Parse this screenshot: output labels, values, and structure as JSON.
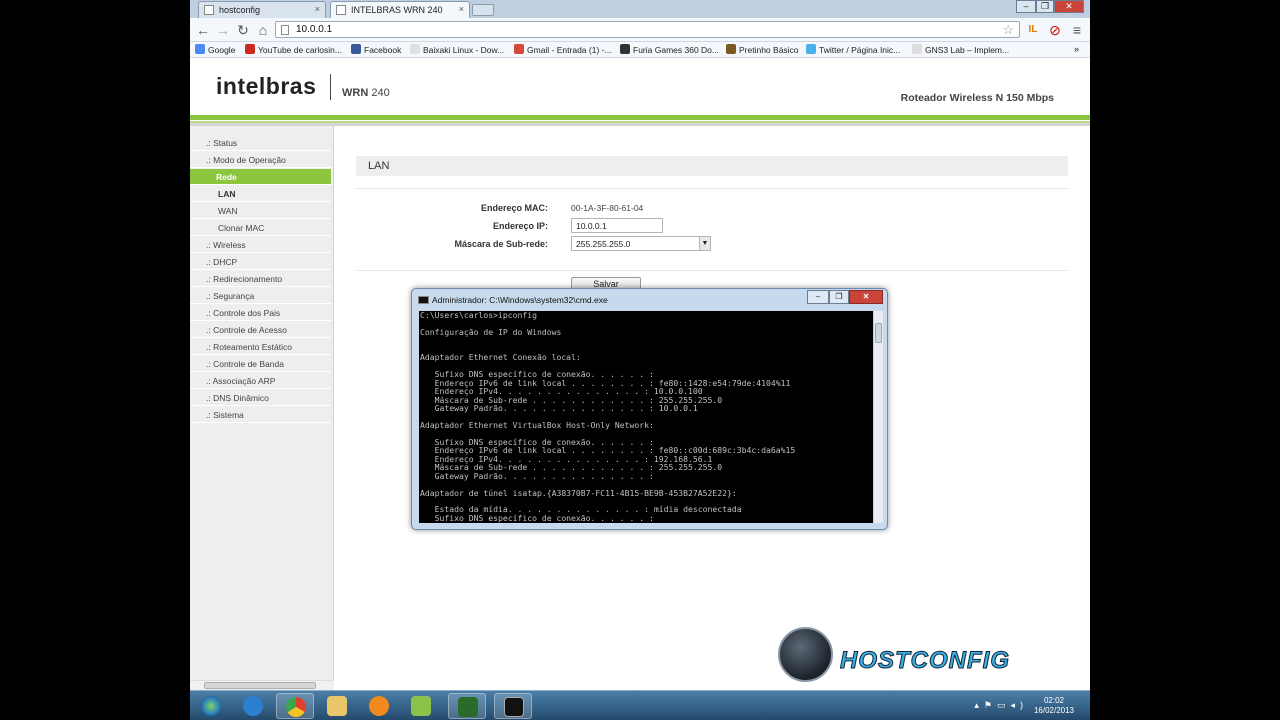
{
  "browser": {
    "tabs": [
      {
        "label": "hostconfig"
      },
      {
        "label": "INTELBRAS WRN 240"
      }
    ],
    "url": "10.0.0.1",
    "bookmarks": [
      {
        "label": "Google",
        "color": "#4a8af4"
      },
      {
        "label": "YouTube de carlosin...",
        "color": "#cc2a1f"
      },
      {
        "label": "Facebook",
        "color": "#3b5998"
      },
      {
        "label": "Baixaki Linux - Dow...",
        "color": "#e0e0e0"
      },
      {
        "label": "Gmail - Entrada (1) -...",
        "color": "#d44a3a"
      },
      {
        "label": "Furia Games 360 Do...",
        "color": "#333333"
      },
      {
        "label": "Pretinho Básico",
        "color": "#7a5a20"
      },
      {
        "label": "Twitter / Página Inic...",
        "color": "#4ab0ea"
      },
      {
        "label": "GNS3 Lab – Implem...",
        "color": "#dddddd"
      }
    ]
  },
  "router": {
    "brand": "intelbras",
    "model_name": "WRN",
    "model_number": "240",
    "description": "Roteador Wireless N 150 Mbps",
    "accent": "#8cc63f"
  },
  "sidebar": {
    "items": [
      {
        "label": ".: Status"
      },
      {
        "label": ".: Modo de Operação"
      },
      {
        "label": "Rede"
      },
      {
        "label": "LAN"
      },
      {
        "label": "WAN"
      },
      {
        "label": "Clonar MAC"
      },
      {
        "label": ".: Wireless"
      },
      {
        "label": ".: DHCP"
      },
      {
        "label": ".: Redirecionamento"
      },
      {
        "label": ".: Segurança"
      },
      {
        "label": ".: Controle dos Pais"
      },
      {
        "label": ".: Controle de Acesso"
      },
      {
        "label": ".: Roteamento Estático"
      },
      {
        "label": ".: Controle de Banda"
      },
      {
        "label": ".: Associação ARP"
      },
      {
        "label": ".: DNS Dinâmico"
      },
      {
        "label": ".: Sistema"
      }
    ]
  },
  "lan": {
    "title": "LAN",
    "mac_label": "Endereço MAC:",
    "mac_value": "00-1A-3F-80-61-04",
    "ip_label": "Endereço IP:",
    "ip_value": "10.0.0.1",
    "mask_label": "Máscara de Sub-rede:",
    "mask_value": "255.255.255.0",
    "save_label": "Salvar"
  },
  "cmd": {
    "title": "Administrador: C:\\Windows\\system32\\cmd.exe",
    "output": "C:\\Users\\carlos>ipconfig\n\nConfiguração de IP do Windows\n\n\nAdaptador Ethernet Conexão local:\n\n   Sufixo DNS específico de conexão. . . . . . :\n   Endereço IPv6 de link local . . . . . . . . : fe80::1428:e54:79de:4104%11\n   Endereço IPv4. . . . . . . . . . . . . . . : 10.0.0.100\n   Máscara de Sub-rede . . . . . . . . . . . . : 255.255.255.0\n   Gateway Padrão. . . . . . . . . . . . . . . : 10.0.0.1\n\nAdaptador Ethernet VirtualBox Host-Only Network:\n\n   Sufixo DNS específico de conexão. . . . . . :\n   Endereço IPv6 de link local . . . . . . . . : fe80::c00d:689c:3b4c:da6a%15\n   Endereço IPv4. . . . . . . . . . . . . . . : 192.168.56.1\n   Máscara de Sub-rede . . . . . . . . . . . . : 255.255.255.0\n   Gateway Padrão. . . . . . . . . . . . . . . :\n\nAdaptador de túnel isatap.{A38370B7-FC11-4B15-BE9B-453B27A52E22}:\n\n   Estado da mídia. . . . . . . . . . . . . . : mídia desconectada\n   Sufixo DNS específico de conexão. . . . . . :"
  },
  "watermark": {
    "text": "HOSTCONFIG"
  },
  "taskbar": {
    "time": "02:02",
    "date": "16/02/2013"
  }
}
